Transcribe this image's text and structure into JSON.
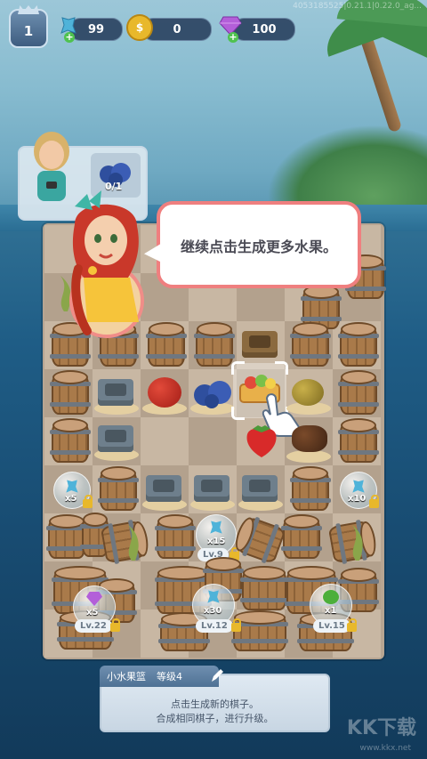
{
  "hud": {
    "level": "1",
    "energy": "99",
    "coins": "0",
    "gems": "100",
    "version": "4053185525|0.21.1|0.22.0_ag..."
  },
  "order": {
    "progress": "0/1",
    "item_icon": "blueberry-icon"
  },
  "tutorial": {
    "message": "继续点击生成更多水果。"
  },
  "board_labels": {
    "gen_left_mult": "x5",
    "gen_right_mult": "x10",
    "chest_mid_mult": "x15",
    "chest_mid_level": "Lv.9",
    "chest_gem_mult": "x5",
    "chest_gem_level": "Lv.22",
    "chest_energy_mult": "x30",
    "chest_energy_level": "Lv.12",
    "chest_green_mult": "x1",
    "chest_green_level": "Lv.15"
  },
  "info_panel": {
    "title": "小水果篮",
    "level": "等级4",
    "line1": "点击生成新的棋子。",
    "line2": "合成相同棋子，进行升级。"
  },
  "watermark": {
    "text": "KK下载",
    "url": "www.kkx.net"
  },
  "colors": {
    "accent_red": "#ef7f7f",
    "energy": "#4fb3d9",
    "coin": "#e8b82b",
    "gem": "#b35fd9"
  }
}
